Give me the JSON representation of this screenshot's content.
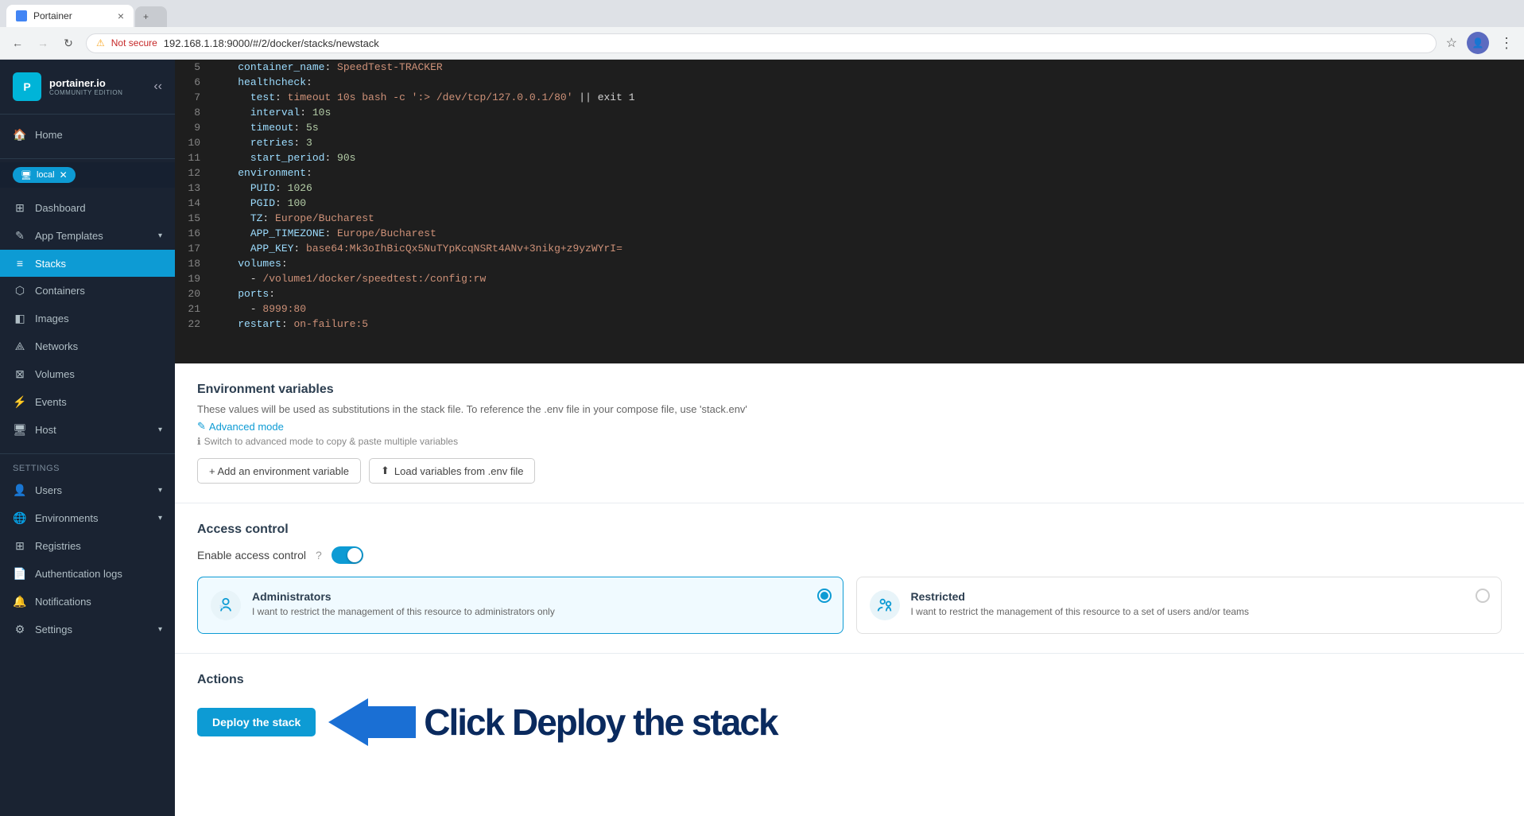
{
  "browser": {
    "tab_active": "Portainer",
    "tab_close": "×",
    "url": "192.168.1.18:9000/#/2/docker/stacks/newstack",
    "security_label": "Not secure",
    "nav_back_disabled": false,
    "nav_forward_disabled": true
  },
  "sidebar": {
    "logo_text": "portainer.io",
    "logo_sub": "COMMUNITY EDITION",
    "env_name": "local",
    "items_top": [
      {
        "label": "Home",
        "icon": "🏠"
      }
    ],
    "env_items": [
      {
        "label": "Dashboard",
        "icon": "⊞",
        "active": false
      },
      {
        "label": "App Templates",
        "icon": "✎",
        "active": false,
        "hasArrow": true
      },
      {
        "label": "Stacks",
        "icon": "≡",
        "active": true
      },
      {
        "label": "Containers",
        "icon": "⬡",
        "active": false
      },
      {
        "label": "Images",
        "icon": "◧",
        "active": false
      },
      {
        "label": "Networks",
        "icon": "⟁",
        "active": false
      },
      {
        "label": "Volumes",
        "icon": "⊠",
        "active": false
      },
      {
        "label": "Events",
        "icon": "⚡",
        "active": false
      },
      {
        "label": "Host",
        "icon": "🖥",
        "active": false,
        "hasArrow": true
      }
    ],
    "settings_label": "Settings",
    "settings_items": [
      {
        "label": "Users",
        "icon": "👤",
        "hasArrow": true
      },
      {
        "label": "Environments",
        "icon": "🌐",
        "hasArrow": true
      },
      {
        "label": "Registries",
        "icon": "⊞",
        "hasArrow": false
      },
      {
        "label": "Authentication logs",
        "icon": "📄",
        "hasArrow": false
      },
      {
        "label": "Notifications",
        "icon": "🔔",
        "hasArrow": false
      },
      {
        "label": "Settings",
        "icon": "⚙",
        "hasArrow": true
      }
    ]
  },
  "code": {
    "lines": [
      {
        "num": 5,
        "content": "    container_name: SpeedTest-TRACKER"
      },
      {
        "num": 6,
        "content": "    healthcheck:"
      },
      {
        "num": 7,
        "content": "      test: timeout 10s bash -c ':> /dev/tcp/127.0.0.1/80' || exit 1"
      },
      {
        "num": 8,
        "content": "      interval: 10s"
      },
      {
        "num": 9,
        "content": "      timeout: 5s"
      },
      {
        "num": 10,
        "content": "      retries: 3"
      },
      {
        "num": 11,
        "content": "      start_period: 90s"
      },
      {
        "num": 12,
        "content": "    environment:"
      },
      {
        "num": 13,
        "content": "      PUID: 1026"
      },
      {
        "num": 14,
        "content": "      PGID: 100"
      },
      {
        "num": 15,
        "content": "      TZ: Europe/Bucharest"
      },
      {
        "num": 16,
        "content": "      APP_TIMEZONE: Europe/Bucharest"
      },
      {
        "num": 17,
        "content": "      APP_KEY: base64:Mk3oIhBicQx5NuTYpKcqNSRt4ANv+3nikg+z9yzWYrI="
      },
      {
        "num": 18,
        "content": "    volumes:"
      },
      {
        "num": 19,
        "content": "      - /volume1/docker/speedtest:/config:rw"
      },
      {
        "num": 20,
        "content": "    ports:"
      },
      {
        "num": 21,
        "content": "      - 8999:80"
      },
      {
        "num": 22,
        "content": "    restart: on-failure:5"
      }
    ]
  },
  "env_variables": {
    "title": "Environment variables",
    "desc": "These values will be used as substitutions in the stack file. To reference the .env file in your compose file, use 'stack.env'",
    "link_advanced": "Advanced mode",
    "hint": "Switch to advanced mode to copy & paste multiple variables",
    "btn_add": "+ Add an environment variable",
    "btn_load": "Load variables from .env file"
  },
  "access_control": {
    "title": "Access control",
    "label": "Enable access control",
    "enabled": true,
    "cards": [
      {
        "id": "administrators",
        "title": "Administrators",
        "desc": "I want to restrict the management of this resource to administrators only",
        "selected": true
      },
      {
        "id": "restricted",
        "title": "Restricted",
        "desc": "I want to restrict the management of this resource to a set of users and/or teams",
        "selected": false
      }
    ]
  },
  "actions": {
    "title": "Actions",
    "deploy_label": "Deploy the stack",
    "annotation": "Click Deploy the stack"
  }
}
